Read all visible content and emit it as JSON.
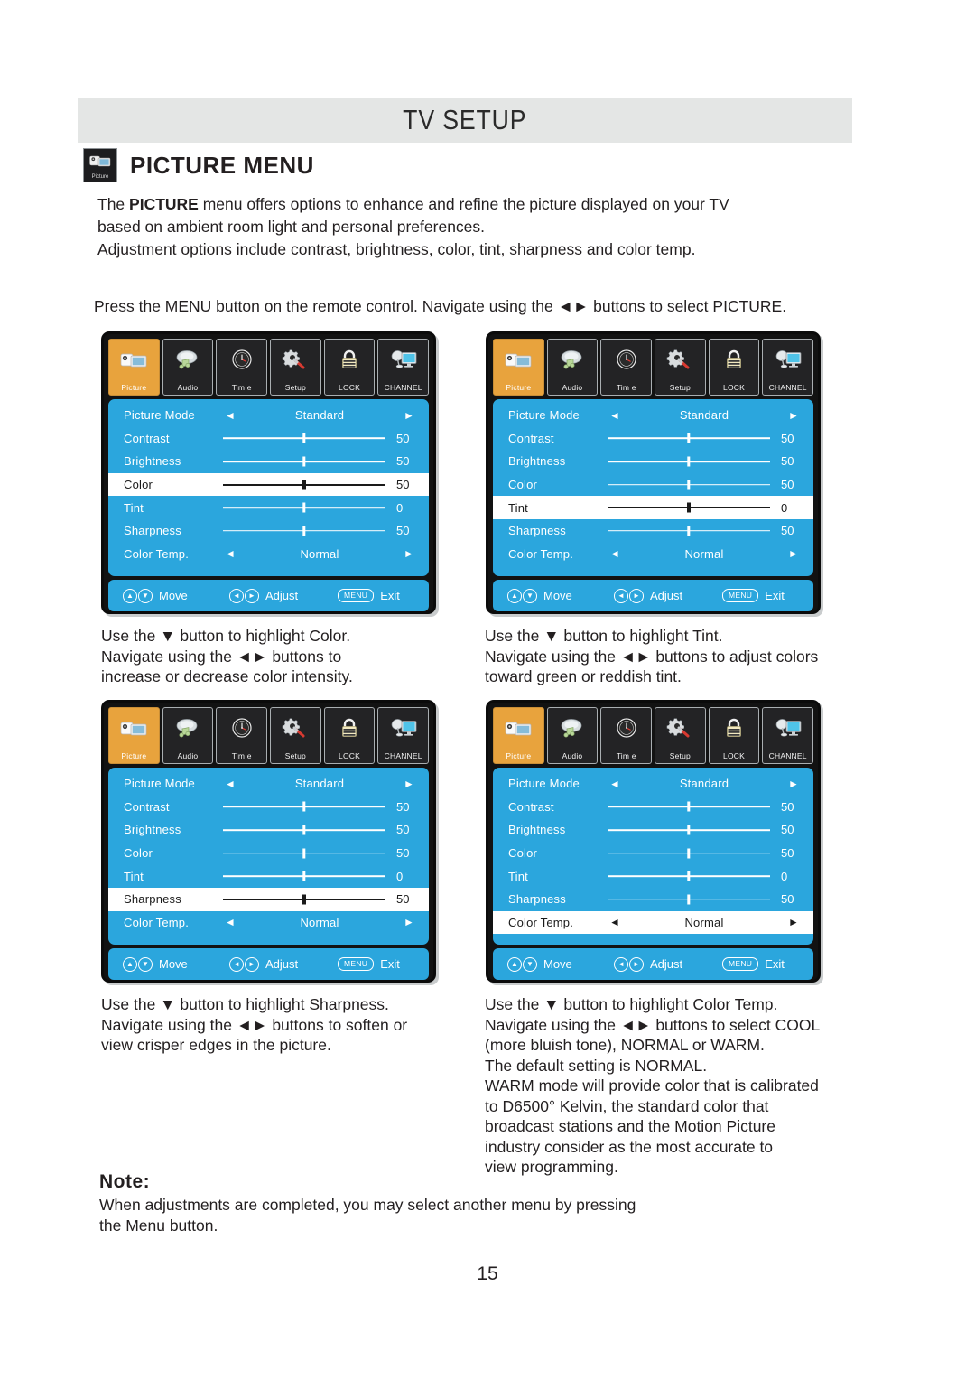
{
  "header": {
    "band_title": "TV SETUP",
    "section_title": "PICTURE MENU",
    "section_icon": "picture-camcorder-icon",
    "section_icon_caption": "Picture"
  },
  "intro": {
    "line1_pre": "The ",
    "line1_bold": "PICTURE",
    "line1_post": " menu offers options to enhance and refine the picture displayed on your TV\nbased on ambient room light and personal preferences.\nAdjustment options include contrast, brightness, color, tint, sharpness and color temp."
  },
  "press_instruction": "Press the MENU button on the remote control. Navigate using the ◄► buttons to select PICTURE.",
  "tabs": [
    {
      "label": "Picture",
      "icon": "camcorder-icon",
      "active": true
    },
    {
      "label": "Audio",
      "icon": "speaker-note-icon",
      "active": false
    },
    {
      "label": "Tim e",
      "icon": "clock-icon",
      "active": false
    },
    {
      "label": "Setup",
      "icon": "gear-screwdriver-icon",
      "active": false
    },
    {
      "label": "LOCK",
      "icon": "padlock-icon",
      "active": false
    },
    {
      "label": "CHANNEL",
      "icon": "satellite-monitor-icon",
      "active": false
    }
  ],
  "footer": {
    "move_label": "Move",
    "adjust_label": "Adjust",
    "exit_label": "Exit",
    "menu_key_label": "MENU",
    "up_glyph": "▲",
    "down_glyph": "▼",
    "left_glyph": "◄",
    "right_glyph": "►"
  },
  "menu_rows": {
    "picture_mode": {
      "name": "Picture Mode",
      "value": "Standard",
      "type": "option"
    },
    "contrast": {
      "name": "Contrast",
      "value": "50",
      "type": "slider",
      "pos": 50
    },
    "brightness": {
      "name": "Brightness",
      "value": "50",
      "type": "slider",
      "pos": 50
    },
    "color": {
      "name": "Color",
      "value": "50",
      "type": "slider",
      "pos": 50
    },
    "tint": {
      "name": "Tint",
      "value": "0",
      "type": "slider",
      "pos": 50
    },
    "sharpness": {
      "name": "Sharpness",
      "value": "50",
      "type": "slider",
      "pos": 50
    },
    "color_temp": {
      "name": "Color Temp.",
      "value": "Normal",
      "type": "option"
    }
  },
  "screens": [
    {
      "id": "menu-color-selected",
      "selected": "color"
    },
    {
      "id": "menu-tint-selected",
      "selected": "tint"
    },
    {
      "id": "menu-sharpness-selected",
      "selected": "sharpness"
    },
    {
      "id": "menu-color-temp-selected",
      "selected": "color_temp"
    }
  ],
  "captions": {
    "color": "Use the ▼ button to highlight Color.\nNavigate using the ◄► buttons to\nincrease or decrease color intensity.",
    "tint": "Use the ▼ button to highlight Tint.\nNavigate using the ◄► buttons to adjust colors\ntoward green or reddish tint.",
    "sharpness": "Use the ▼ button to highlight Sharpness.\nNavigate using the ◄► buttons to soften or\nview crisper edges in the picture.",
    "color_temp": "Use the ▼ button to highlight Color Temp.\nNavigate using the ◄► buttons to select COOL\n(more bluish tone), NORMAL or WARM.\nThe default setting is NORMAL.\nWARM mode will provide color that is calibrated\nto D6500° Kelvin, the standard color that\nbroadcast stations and the Motion Picture\nindustry consider as the most accurate to\nview programming."
  },
  "note": {
    "heading": "Note:",
    "body": "When adjustments are completed, you may select another menu by pressing\nthe Menu button."
  },
  "page_number": "15",
  "colors": {
    "band_bg": "#e4e6e5",
    "panel_blue": "#2ba6dd",
    "tab_active": "#e8a33d",
    "tab_bg": "#232325",
    "osd_border": "#0b0b0b",
    "text": "#231f20"
  }
}
